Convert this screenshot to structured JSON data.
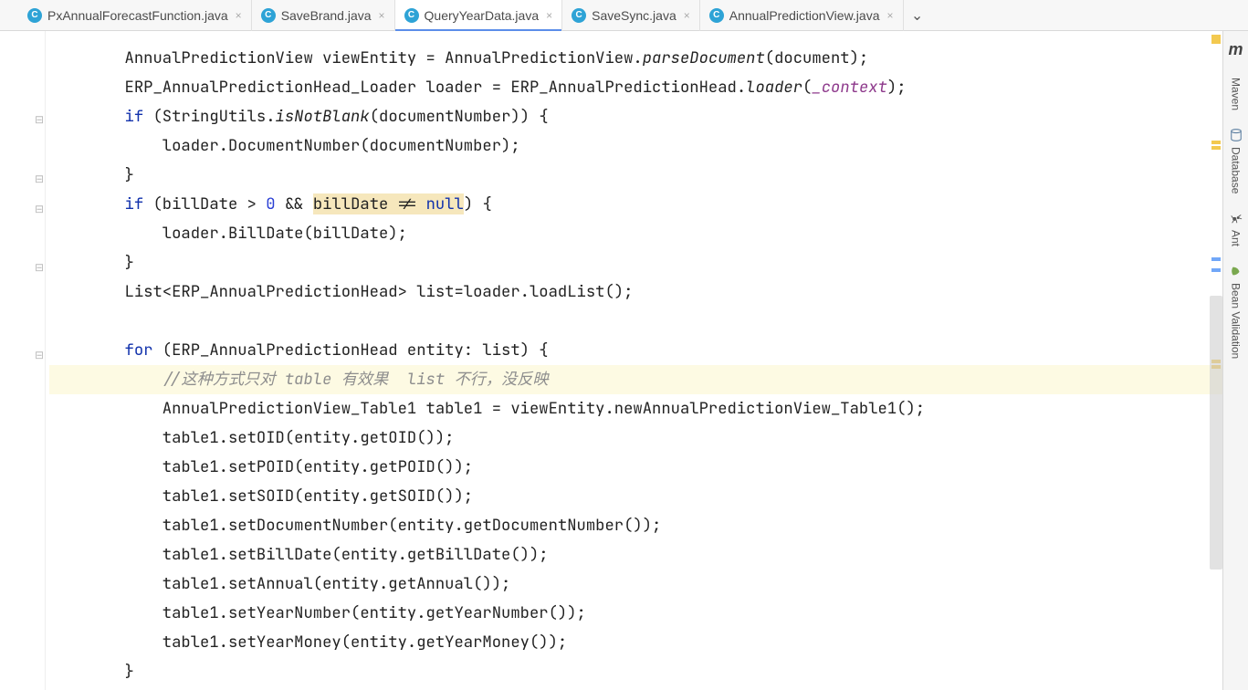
{
  "tabs": [
    {
      "label": "PxAnnualForecastFunction.java",
      "active": false
    },
    {
      "label": "SaveBrand.java",
      "active": false
    },
    {
      "label": "QueryYearData.java",
      "active": true
    },
    {
      "label": "SaveSync.java",
      "active": false
    },
    {
      "label": "AnnualPredictionView.java",
      "active": false
    }
  ],
  "right_tools": {
    "logo": "m",
    "items": [
      "Maven",
      "Database",
      "Ant",
      "Bean Validation"
    ]
  },
  "code": {
    "indent2": "        ",
    "indent3": "            ",
    "indent4": "                ",
    "l1a": "AnnualPredictionView viewEntity = AnnualPredictionView.",
    "l1b": "parseDocument",
    "l1c": "(document);",
    "l2a": "ERP_AnnualPredictionHead_Loader loader = ERP_AnnualPredictionHead.",
    "l2b": "loader",
    "l2c": "(",
    "l2d": "_context",
    "l2e": ");",
    "l3a": "if",
    "l3b": " (StringUtils.",
    "l3c": "isNotBlank",
    "l3d": "(documentNumber)) {",
    "l4": "loader.DocumentNumber(documentNumber);",
    "l5": "}",
    "l6a": "if",
    "l6b": " (billDate > ",
    "l6c": "0",
    "l6d": " && ",
    "l6e": "billDate != ",
    "l6f": "null",
    "l6g": ") {",
    "l7": "loader.BillDate(billDate);",
    "l8": "}",
    "l9": "List<ERP_AnnualPredictionHead> list=loader.loadList();",
    "l11a": "for",
    "l11b": " (ERP_AnnualPredictionHead entity: list) {",
    "l12": "//这种方式只对 table 有效果  list 不行，没反映",
    "l13": "AnnualPredictionView_Table1 table1 = viewEntity.newAnnualPredictionView_Table1();",
    "l14": "table1.setOID(entity.getOID());",
    "l15": "table1.setPOID(entity.getPOID());",
    "l16": "table1.setSOID(entity.getSOID());",
    "l17": "table1.setDocumentNumber(entity.getDocumentNumber());",
    "l18": "table1.setBillDate(entity.getBillDate());",
    "l19": "table1.setAnnual(entity.getAnnual());",
    "l20": "table1.setYearNumber(entity.getYearNumber());",
    "l21": "table1.setYearMoney(entity.getYearMoney());",
    "l22": "}"
  }
}
